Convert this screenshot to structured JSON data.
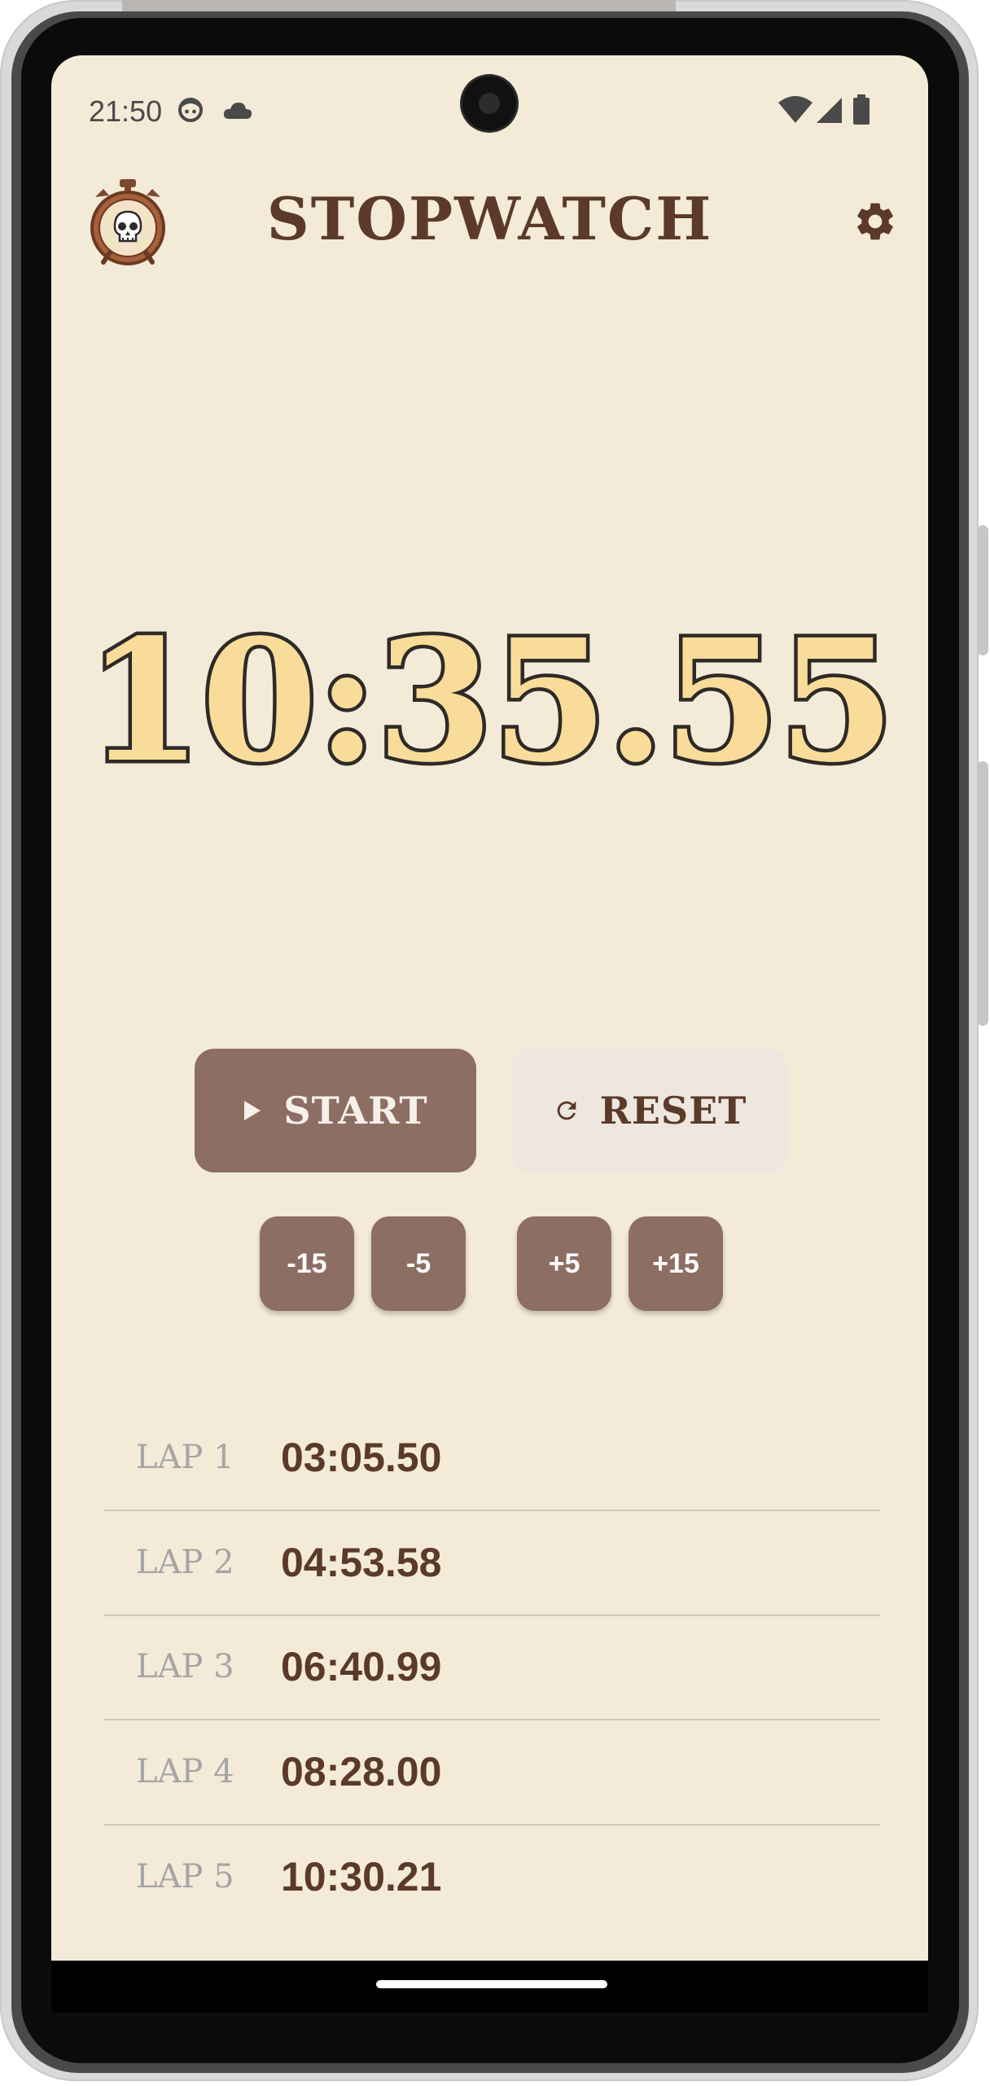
{
  "status_bar": {
    "time": "21:50",
    "icons": [
      "face-icon",
      "cloud-icon",
      "wifi-icon",
      "signal-icon",
      "battery-icon"
    ]
  },
  "app_bar": {
    "title": "STOPWATCH",
    "logo_icon": "skull-stopwatch-icon",
    "settings_icon": "gear-icon"
  },
  "timer": {
    "display": "10:35.55"
  },
  "controls": {
    "start_label": "START",
    "reset_label": "RESET",
    "adjust": [
      "-15",
      "-5",
      "+5",
      "+15"
    ]
  },
  "laps": [
    {
      "label": "LAP 1",
      "time": "03:05.50"
    },
    {
      "label": "LAP 2",
      "time": "04:53.58"
    },
    {
      "label": "LAP 3",
      "time": "06:40.99"
    },
    {
      "label": "LAP 4",
      "time": "08:28.00"
    },
    {
      "label": "LAP 5",
      "time": "10:30.21"
    }
  ],
  "colors": {
    "background": "#f4ead8",
    "primary_brown": "#8d6e63",
    "dark_brown": "#5b3a29",
    "bone": "#f9dc99",
    "reset_bg": "#eee7e0"
  }
}
